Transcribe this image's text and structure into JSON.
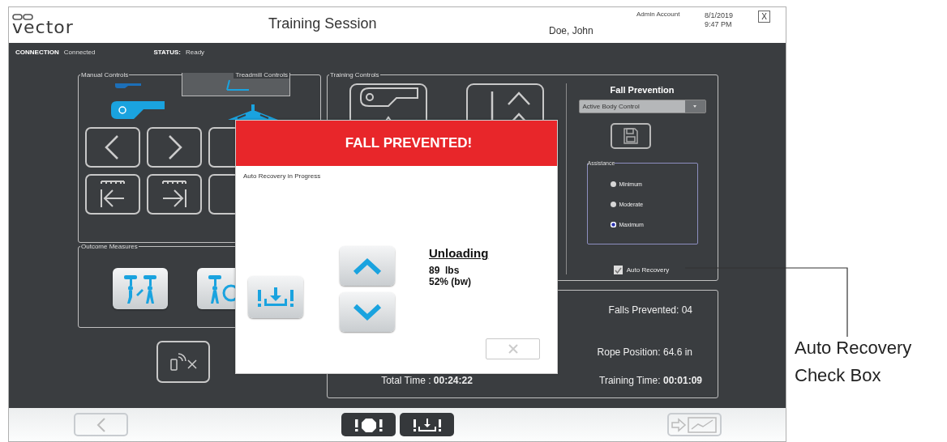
{
  "header": {
    "logo": "vector",
    "title": "Training Session",
    "patient": "Doe, John",
    "account": "Admin Account",
    "date": "8/1/2019",
    "time": "9:47 PM",
    "close": "X"
  },
  "status_line": [
    {
      "label": "CONNECTION",
      "value": "Connected"
    },
    {
      "label": "STATUS:",
      "value": "Ready"
    }
  ],
  "manual_controls": {
    "title": "Manual Controls",
    "tabs": [
      {
        "label": "Treadmill Controls",
        "selected": true
      }
    ]
  },
  "outcome_measures": {
    "title": "Outcome Measures"
  },
  "training_controls": {
    "title": "Training Controls",
    "fall_prevention": {
      "title": "Fall Prevention",
      "mode": "Active Body Control",
      "assistance": {
        "title": "Assistance",
        "options": [
          {
            "label": "Minimum",
            "selected": false
          },
          {
            "label": "Moderate",
            "selected": false
          },
          {
            "label": "Maximum",
            "selected": true
          }
        ]
      },
      "auto_recovery": {
        "label": "Auto Recovery",
        "checked": true
      }
    }
  },
  "stats": {
    "falls_prevented": "Falls Prevented: 04",
    "rope_position": "Rope Position: 64.6 in",
    "total_time": {
      "label": "Total Time : ",
      "value": "00:24:22"
    },
    "training_time": {
      "label": "Training Time: ",
      "value": "00:01:09"
    }
  },
  "dialog": {
    "title": "FALL PREVENTED!",
    "message": "Auto Recovery in Progress",
    "unloading": {
      "title": "Unloading",
      "weight": "89  lbs",
      "percent": "52% (bw)"
    }
  },
  "callout": "Auto Recovery Check Box"
}
